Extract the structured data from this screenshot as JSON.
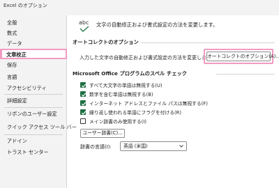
{
  "window": {
    "title": "Excel のオプション"
  },
  "sidebar": {
    "items": [
      {
        "label": "全般"
      },
      {
        "label": "数式"
      },
      {
        "label": "データ"
      },
      {
        "label": "文章校正"
      },
      {
        "label": "保存"
      },
      {
        "label": "言語"
      },
      {
        "label": "アクセシビリティ"
      },
      {
        "label": "詳細設定"
      },
      {
        "label": "リボンのユーザー設定"
      },
      {
        "label": "クイック アクセス ツール バー"
      },
      {
        "label": "アドイン"
      },
      {
        "label": "トラスト センター"
      }
    ],
    "selected": "文章校正"
  },
  "header": {
    "icon_text": "abc",
    "text": "文字の自動修正および書式設定の方法を変更します。"
  },
  "autocorrect": {
    "title": "オートコレクトのオプション",
    "description": "入力した文字の自動修正および書式設定の方法を変更します:",
    "button_label": "オートコレクトのオプション(A)..."
  },
  "spelling": {
    "title": "Microsoft Office プログラムのスペル チェック",
    "options": [
      {
        "label": "すべて大文字の単語は無視する(U)",
        "checked": true
      },
      {
        "label": "数字を含む単語は無視する(B)",
        "checked": true
      },
      {
        "label": "インターネット アドレスとファイル パスは無視する(F)",
        "checked": true
      },
      {
        "label": "繰り返し使われる単語にフラグを付ける(R)",
        "checked": true
      },
      {
        "label": "メイン辞書のみ使用する(I)",
        "checked": false
      }
    ],
    "user_dictionary_button": "ユーザー辞書(C)...",
    "dictionary_language_label": "辞書の言語(I):",
    "dictionary_language_value": "英語 (米国)"
  },
  "colors": {
    "highlight": "#f29ac2",
    "checkbox": "#1f6e43"
  }
}
